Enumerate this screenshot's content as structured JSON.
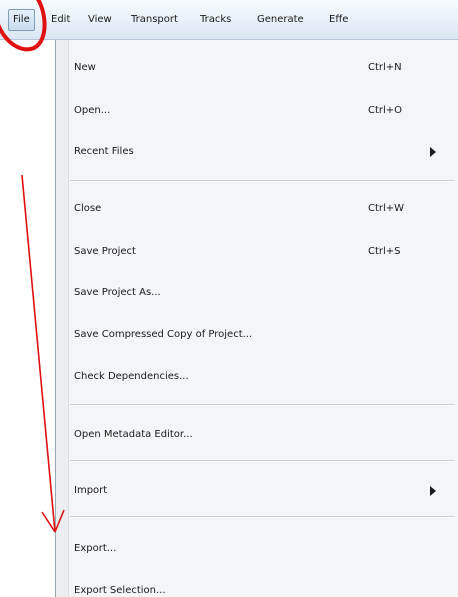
{
  "menubar": {
    "items": [
      {
        "label": "File",
        "active": true
      },
      {
        "label": "Edit"
      },
      {
        "label": "View"
      },
      {
        "label": "Transport"
      },
      {
        "label": "Tracks"
      },
      {
        "label": "Generate"
      },
      {
        "label": "Effe"
      }
    ]
  },
  "file_menu": {
    "items": [
      {
        "label": "New",
        "shortcut": "Ctrl+N"
      },
      {
        "label": "Open...",
        "shortcut": "Ctrl+O"
      },
      {
        "label": "Recent Files",
        "submenu": true
      },
      {
        "label": "Close",
        "shortcut": "Ctrl+W"
      },
      {
        "label": "Save Project",
        "shortcut": "Ctrl+S"
      },
      {
        "label": "Save Project As..."
      },
      {
        "label": "Save Compressed Copy of Project..."
      },
      {
        "label": "Check Dependencies..."
      },
      {
        "label": "Open Metadata Editor..."
      },
      {
        "label": "Import",
        "submenu": true
      },
      {
        "label": "Export..."
      },
      {
        "label": "Export Selection..."
      }
    ]
  },
  "annotation": {
    "color": "#e01010"
  },
  "colors": {
    "menu_background": "#f4f5f7",
    "menubar_background": "#dbe6f3",
    "text": "#1a1a1a"
  }
}
